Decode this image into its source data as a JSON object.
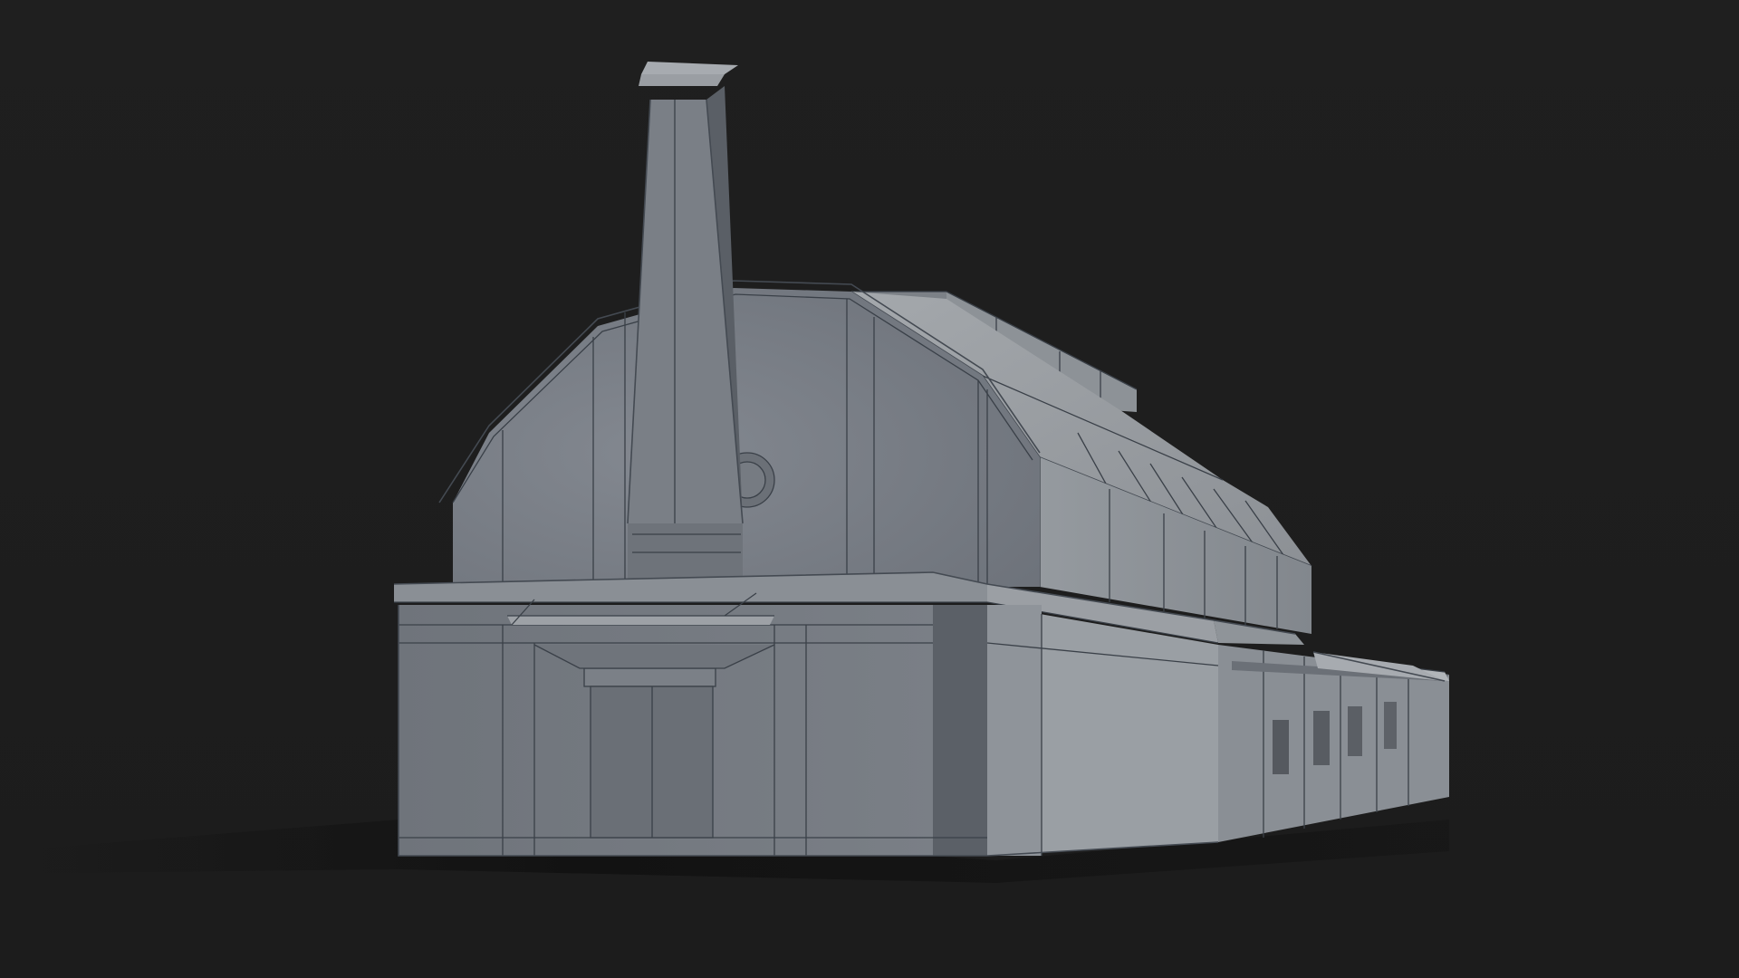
{
  "scene": {
    "subject": "industrial-building-clay-render",
    "colors": {
      "background": "#1e1e1e",
      "clay_lit": "#8f9499",
      "clay_mid": "#7a7f85",
      "clay_dark": "#5e636a",
      "clay_shadow": "#4e535a",
      "edge_lines": "#3a4048",
      "ground_shadow": "#141414"
    }
  }
}
